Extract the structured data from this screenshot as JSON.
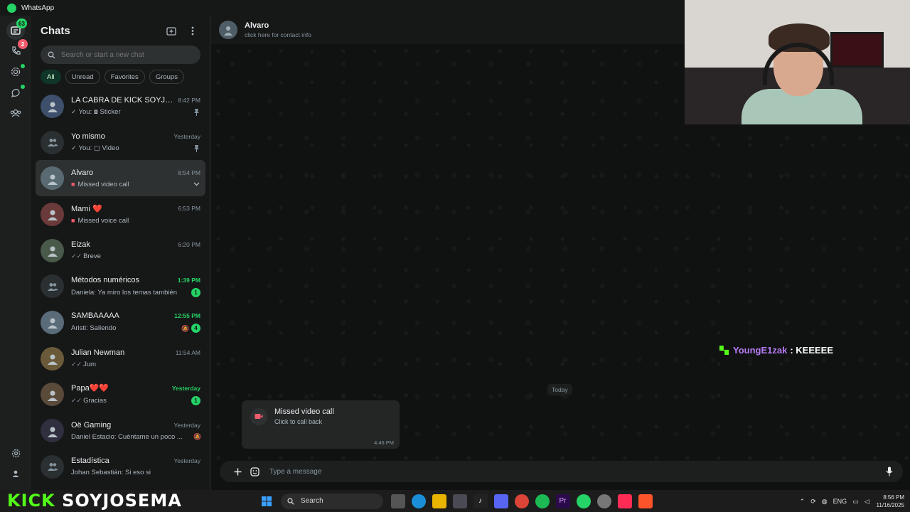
{
  "window": {
    "title": "WhatsApp"
  },
  "rail": {
    "chats_badge": "63",
    "calls_badge": "2"
  },
  "sidebar": {
    "title": "Chats",
    "search_placeholder": "Search or start a new chat",
    "filters": [
      "All",
      "Unread",
      "Favorites",
      "Groups"
    ],
    "chats": [
      {
        "name": "LA CABRA DE KICK SOYJO...",
        "time": "8:42 PM",
        "preview": "You: ⧇ Sticker",
        "pinned": true,
        "unread": "",
        "time_green": false,
        "missed": false,
        "group": false
      },
      {
        "name": "Yo mismo",
        "time": "Yesterday",
        "preview": "You: ▢ Video",
        "pinned": true,
        "unread": "",
        "time_green": false,
        "missed": false,
        "group": true
      },
      {
        "name": "Alvaro",
        "time": "8:54 PM",
        "preview": "Missed video call",
        "pinned": false,
        "unread": "",
        "time_green": false,
        "missed": true,
        "group": false,
        "selected": true
      },
      {
        "name": "Mami ❤️",
        "time": "6:53 PM",
        "preview": "Missed voice call",
        "pinned": false,
        "unread": "",
        "time_green": false,
        "missed": true,
        "group": false
      },
      {
        "name": "Eizak",
        "time": "6:20 PM",
        "preview": "Breve",
        "pinned": false,
        "unread": "",
        "time_green": false,
        "missed": false,
        "group": false
      },
      {
        "name": "Métodos numéricos",
        "time": "1:39 PM",
        "preview": "Daniela: Ya miro los temas también",
        "pinned": false,
        "unread": "1",
        "time_green": true,
        "missed": false,
        "group": true
      },
      {
        "name": "SAMBAAAAA",
        "time": "12:55 PM",
        "preview": "Aristi: Saliendo",
        "pinned": false,
        "unread": "4",
        "time_green": true,
        "missed": false,
        "group": false,
        "muted": true
      },
      {
        "name": "Julian Newman",
        "time": "11:54 AM",
        "preview": "Jum",
        "pinned": false,
        "unread": "",
        "time_green": false,
        "missed": false,
        "group": false
      },
      {
        "name": "Papa❤️❤️",
        "time": "Yesterday",
        "preview": "Gracias",
        "pinned": false,
        "unread": "1",
        "time_green": true,
        "missed": false,
        "group": false
      },
      {
        "name": "Oë Gaming",
        "time": "Yesterday",
        "preview": "Daniel Estacio: Cuéntame un poco ...",
        "pinned": false,
        "unread": "",
        "time_green": false,
        "missed": false,
        "group": false,
        "muted": true
      },
      {
        "name": "Estadística",
        "time": "Yesterday",
        "preview": "Johan Sebastián: Si eso si",
        "pinned": false,
        "unread": "",
        "time_green": false,
        "missed": false,
        "group": true
      }
    ]
  },
  "conversation": {
    "contact_name": "Alvaro",
    "contact_sub": "click here for contact info",
    "date_divider": "Today",
    "call_title": "Missed video call",
    "call_sub": "Click to call back",
    "call_time": "4:46 PM",
    "composer_placeholder": "Type a message"
  },
  "stream_overlay": {
    "chat_user": "YoungE1zak",
    "chat_message": ": KEEEEE",
    "channel_prefix": "KICK",
    "channel_name": " SOYJOSEMA"
  },
  "taskbar": {
    "search_label": "Search",
    "language": "ENG",
    "time": "8:56 PM",
    "date": "11/16/2025"
  },
  "colors": {
    "accent": "#25d366",
    "missed": "#f15c6d",
    "kick_green": "#53fc18",
    "overlay_user": "#b77cf5"
  }
}
